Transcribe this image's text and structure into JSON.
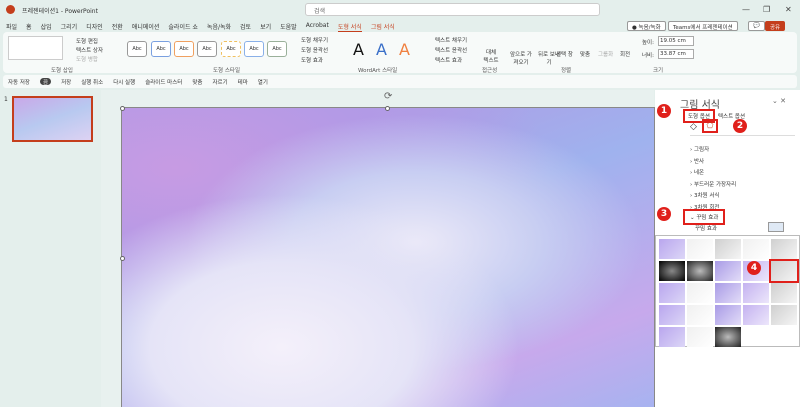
{
  "app": {
    "title": "프레젠테이션1 - PowerPoint",
    "search_placeholder": "검색",
    "minimize": "—",
    "restore": "❐",
    "close": "✕"
  },
  "tabs": [
    "파일",
    "홈",
    "삽입",
    "그리기",
    "디자인",
    "전환",
    "애니메이션",
    "슬라이드 쇼",
    "녹음/녹화",
    "검토",
    "보기",
    "도움말",
    "Acrobat",
    "도형 서식",
    "그림 서식"
  ],
  "top_buttons": {
    "record": "● 녹음/녹화",
    "teams": "Teams에서 프레젠테이션",
    "comment": "💬",
    "share": "공유"
  },
  "ribbon": {
    "shape_edit": "도형 편집",
    "text_box": "텍스트 상자",
    "merge": "도형 병합",
    "group_insert": "도형 삽입",
    "abc": "Abc",
    "group_styles": "도형 스타일",
    "fill": "도형 채우기",
    "outline": "도형 윤곽선",
    "effect": "도형 효과",
    "wordart": "A",
    "group_wordart": "WordArt 스타일",
    "text_fill": "텍스트 채우기",
    "text_outline": "텍스트 윤곽선",
    "text_effect": "텍스트 효과",
    "alt_text": "대체 텍스트",
    "group_access": "접근성",
    "bring_forward": "앞으로 가져오기",
    "send_back": "뒤로 보내기",
    "selection": "선택 창",
    "align": "맞춤",
    "group_btn": "그룹화",
    "rotate": "회전",
    "group_arrange": "정렬",
    "height_label": "높이:",
    "height": "19.05 cm",
    "width_label": "너비:",
    "width": "33.87 cm",
    "group_size": "크기"
  },
  "qat": [
    "자동 저장",
    "끔",
    "저장",
    "실행 취소",
    "다시 실행",
    "슬라이드 마스터",
    "맞춤",
    "자르기",
    "테마",
    "열기"
  ],
  "slide_number": "1",
  "panel": {
    "title": "그림 서식",
    "tab_shape": "도형 옵션",
    "tab_text": "텍스트 옵션",
    "sections": [
      "그림자",
      "반사",
      "네온",
      "부드러운 가장자리",
      "3차원 서식",
      "3차원 회전"
    ],
    "open_section": "꾸밈 효과",
    "sub_label": "꾸밈 효과"
  },
  "badges": [
    "1",
    "2",
    "3",
    "4"
  ],
  "gallery_count": 23
}
